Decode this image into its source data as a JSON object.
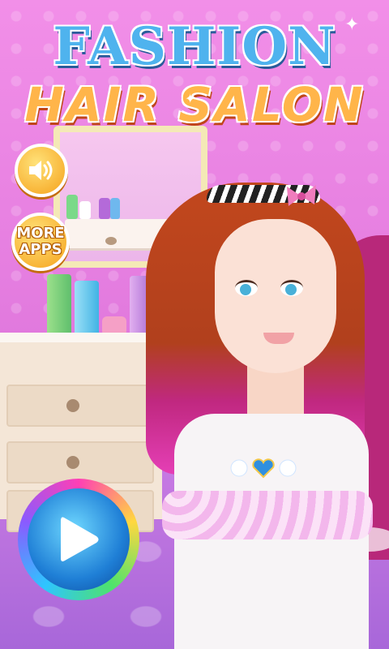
{
  "title": {
    "line1": "FASHION",
    "line2": "HAIR SALON"
  },
  "buttons": {
    "sound_icon": "speaker-volume-icon",
    "more_apps_line1": "MORE",
    "more_apps_line2": "APPS",
    "play_icon": "play-triangle-icon"
  },
  "colors": {
    "title_blue": "#4fb3ee",
    "title_orange": "#ffb54a",
    "button_orange": "#f5a21b",
    "play_blue": "#1f7fd6",
    "hair_pink": "#e53fb6"
  }
}
